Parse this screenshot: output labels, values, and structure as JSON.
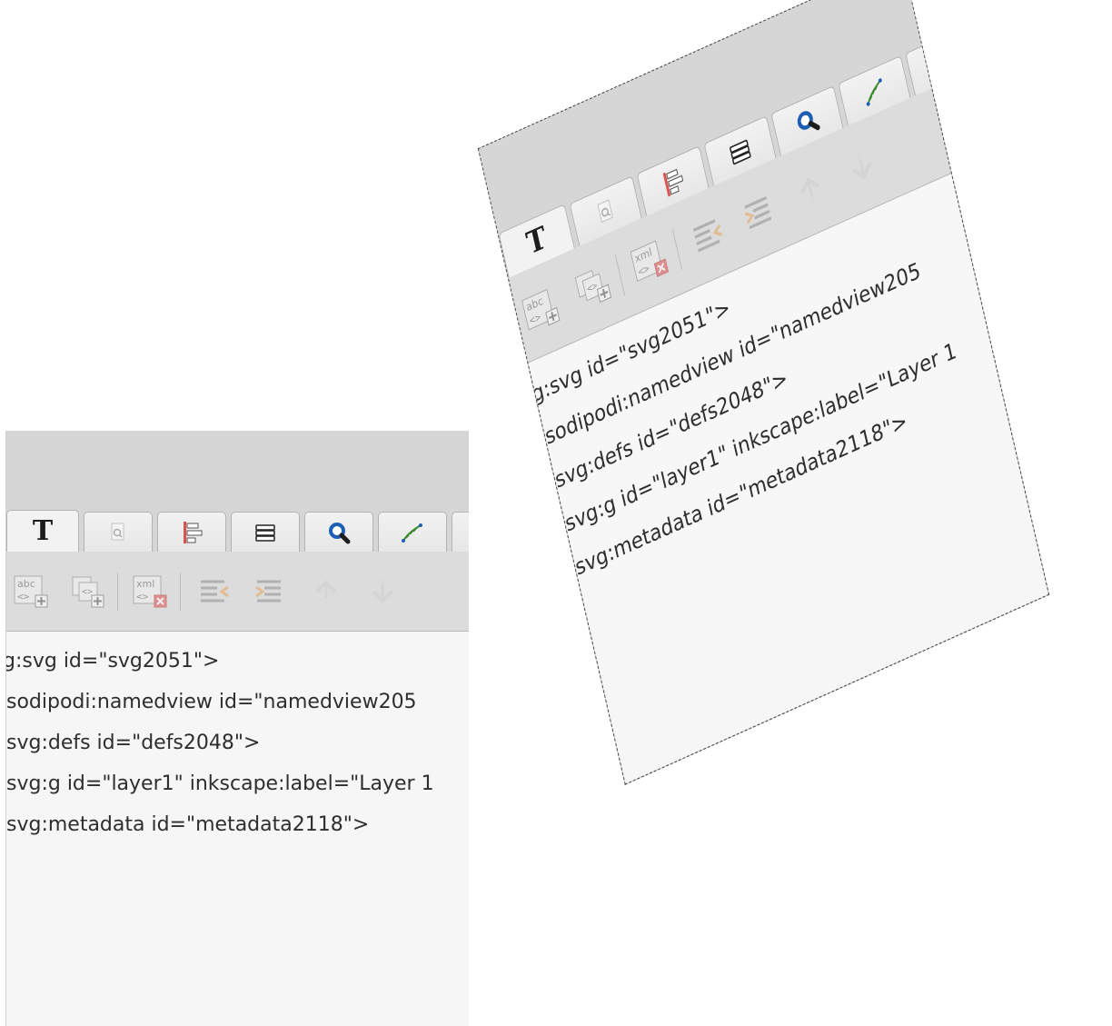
{
  "tabs": [
    {
      "name": "text-font",
      "icon": "text-T-icon"
    },
    {
      "name": "document-properties",
      "icon": "document-magnify-icon"
    },
    {
      "name": "align-distribute",
      "icon": "align-icon"
    },
    {
      "name": "layers",
      "icon": "layers-icon"
    },
    {
      "name": "find",
      "icon": "magnifier-icon"
    },
    {
      "name": "path-effects",
      "icon": "bezier-path-icon"
    }
  ],
  "text_tab_glyph": "T",
  "toolbar": [
    {
      "name": "new-element-node",
      "icon": "abc-tag-plus-icon",
      "label": "abc"
    },
    {
      "name": "new-text-node",
      "icon": "tag-plus-icon"
    },
    {
      "name": "delete-node",
      "icon": "xml-delete-icon",
      "label": "xml"
    },
    {
      "name": "unindent-node",
      "icon": "unindent-icon"
    },
    {
      "name": "indent-node",
      "icon": "indent-icon"
    },
    {
      "name": "raise-node",
      "icon": "raise-icon"
    },
    {
      "name": "lower-node",
      "icon": "lower-icon"
    }
  ],
  "xml_nodes": [
    "g:svg id=\"svg2051\">",
    "sodipodi:namedview id=\"namedview205",
    "svg:defs id=\"defs2048\">",
    "svg:g id=\"layer1\" inkscape:label=\"Layer 1",
    "svg:metadata id=\"metadata2118\">"
  ],
  "colors": {
    "header_bg": "#d6d6d6",
    "toolbar_bg": "#dcdcdc",
    "list_bg": "#f6f6f6",
    "text": "#2e2e2e",
    "accent_red": "#d9534f",
    "accent_blue": "#1f5fb3"
  }
}
